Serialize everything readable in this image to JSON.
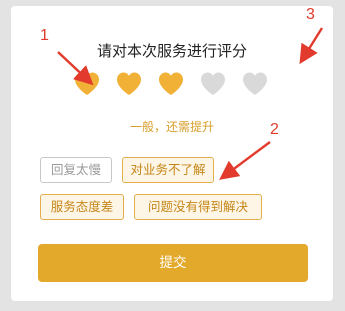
{
  "dialog": {
    "title": "请对本次服务进行评分",
    "rating_value": 3,
    "rating_max": 5,
    "rating_text": "一般，还需提升",
    "tags": [
      {
        "label": "回复太慢",
        "selected": false
      },
      {
        "label": "对业务不了解",
        "selected": true
      },
      {
        "label": "服务态度差",
        "selected": true
      },
      {
        "label": "问题没有得到解决",
        "selected": true
      }
    ],
    "submit_label": "提交"
  },
  "annotations": [
    {
      "label": "1"
    },
    {
      "label": "2"
    },
    {
      "label": "3"
    }
  ],
  "colors": {
    "accent": "#e3a92b",
    "heart_filled": "#f0b136",
    "heart_empty": "#d9d9d9",
    "annotation": "#e23b2e"
  }
}
